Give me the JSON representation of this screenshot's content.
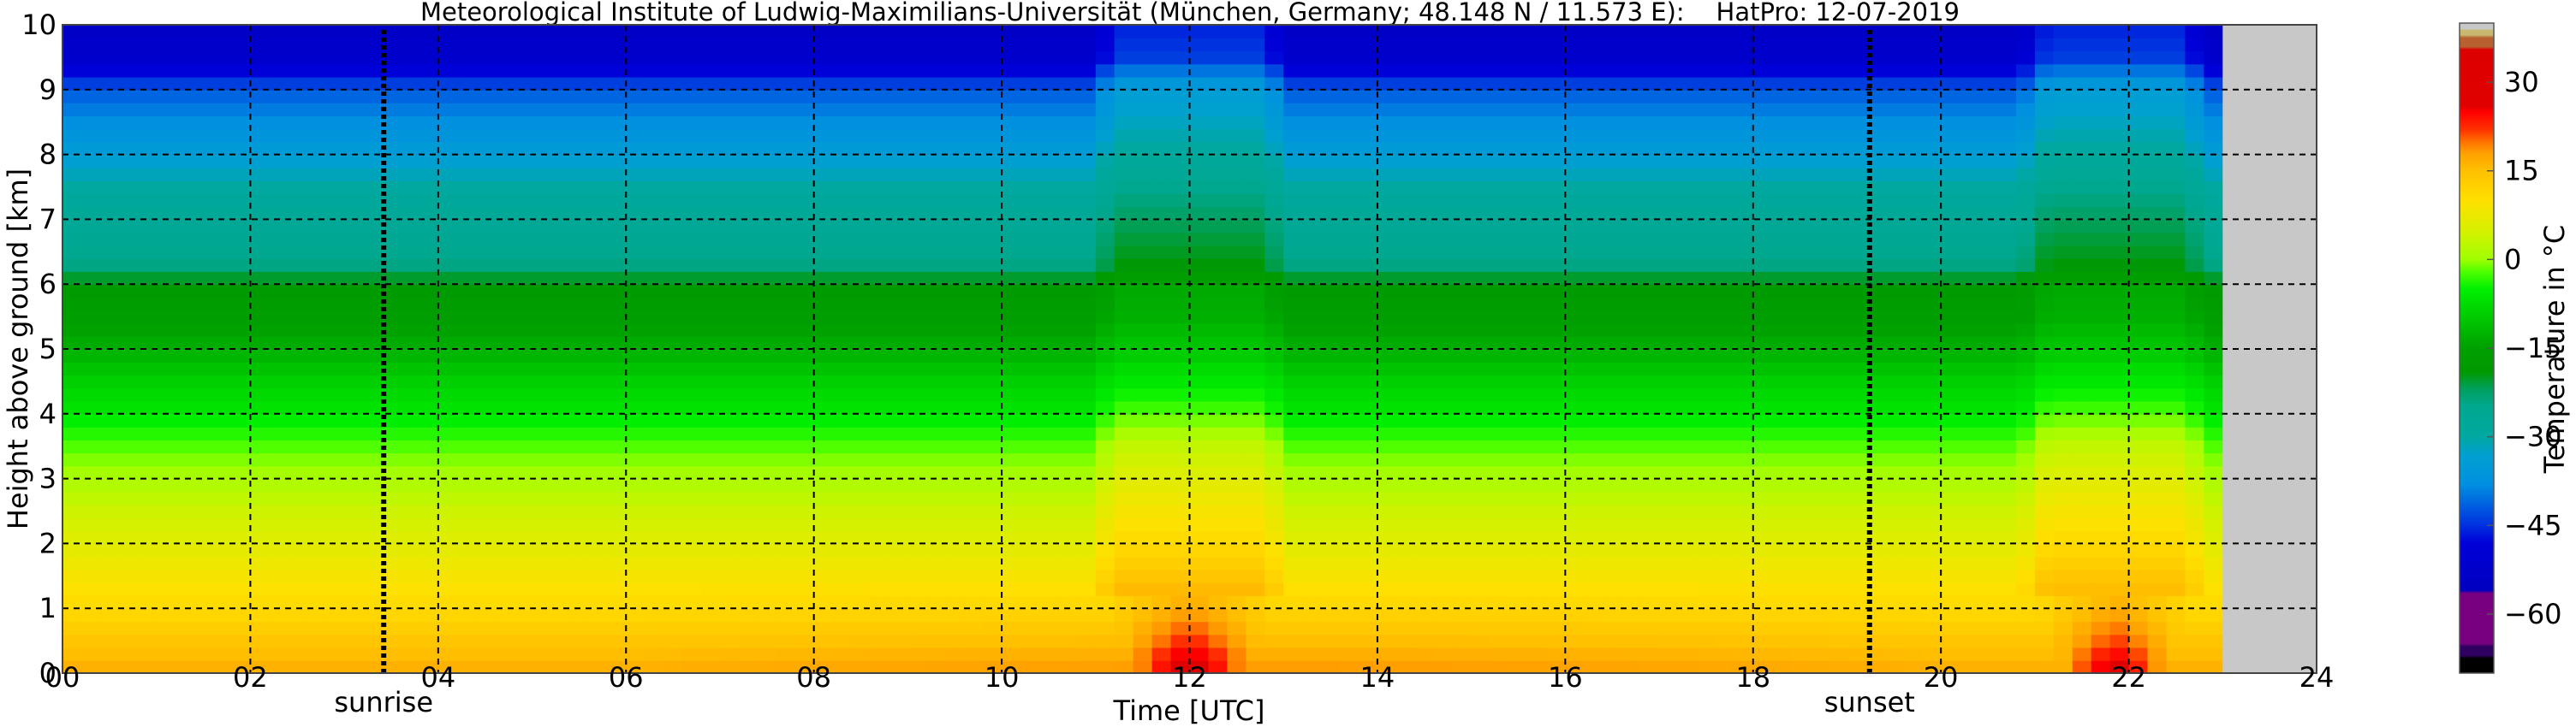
{
  "chart_data": {
    "type": "heatmap",
    "title": "Meteorological Institute of Ludwig-Maximilians-Universität (München, Germany; 48.148 N / 11.573 E):    HatPro: 12-07-2019",
    "xlabel": "Time [UTC]",
    "ylabel": "Height above ground [km]",
    "xlim": [
      0,
      24
    ],
    "ylim": [
      0,
      10
    ],
    "data_end_hour": 23.0,
    "x_ticks": [
      "00",
      "02",
      "04",
      "06",
      "08",
      "10",
      "12",
      "14",
      "16",
      "18",
      "20",
      "22",
      "24"
    ],
    "y_ticks": [
      "0",
      "1",
      "2",
      "3",
      "4",
      "5",
      "6",
      "7",
      "8",
      "9",
      "10"
    ],
    "grid": true,
    "annotations": [
      {
        "label": "sunrise",
        "hour": 3.42
      },
      {
        "label": "sunset",
        "hour": 19.24
      }
    ],
    "profile_heights_km": [
      0,
      0.5,
      1,
      1.5,
      2,
      2.5,
      3,
      3.5,
      4,
      4.5,
      5,
      5.5,
      6,
      6.25,
      6.5,
      7,
      7.5,
      8,
      8.5,
      9,
      9.25,
      9.5,
      10
    ],
    "baseline_temperature_c": [
      17,
      14,
      11,
      9,
      6,
      4,
      1,
      -2,
      -6,
      -9,
      -13,
      -16,
      -18,
      -24,
      -25,
      -27,
      -30,
      -34,
      -38,
      -42,
      -47,
      -52,
      -54
    ],
    "warm_episode_anomaly_c": [
      13,
      8,
      6,
      5,
      5,
      5,
      5,
      5,
      4,
      3,
      3,
      3,
      4,
      5,
      5,
      5,
      5,
      5,
      6,
      8,
      8,
      8,
      8
    ],
    "warm_episodes_hours": [
      [
        11.1,
        12.9
      ],
      [
        21.0,
        22.7
      ]
    ],
    "colorbar": {
      "label": "Temperature in °C",
      "range": [
        -70,
        40
      ],
      "ticks": [
        "30",
        "15",
        "0",
        "−15",
        "−30",
        "−45",
        "−60"
      ],
      "tick_values": [
        30,
        15,
        0,
        -15,
        -30,
        -45,
        -60
      ],
      "stops": [
        [
          -70,
          "#000000"
        ],
        [
          -67.5,
          "#000000"
        ],
        [
          -67,
          "#300060"
        ],
        [
          -65.5,
          "#300060"
        ],
        [
          -65,
          "#780080"
        ],
        [
          -56.5,
          "#780080"
        ],
        [
          -56,
          "#0000c0"
        ],
        [
          -48,
          "#0000d8"
        ],
        [
          -45,
          "#0030e0"
        ],
        [
          -41,
          "#0068e0"
        ],
        [
          -38,
          "#0090e0"
        ],
        [
          -33,
          "#00a0d0"
        ],
        [
          -30,
          "#00a8a0"
        ],
        [
          -25,
          "#00a890"
        ],
        [
          -22,
          "#00a060"
        ],
        [
          -19,
          "#009900"
        ],
        [
          -15,
          "#00a000"
        ],
        [
          -10,
          "#00c800"
        ],
        [
          -5,
          "#00f000"
        ],
        [
          -2,
          "#50ff00"
        ],
        [
          0,
          "#a0ff00"
        ],
        [
          5,
          "#d8f000"
        ],
        [
          10,
          "#ffe000"
        ],
        [
          15,
          "#ffc000"
        ],
        [
          18,
          "#ffa000"
        ],
        [
          20,
          "#ff7000"
        ],
        [
          22,
          "#ff3000"
        ],
        [
          25,
          "#ff0000"
        ],
        [
          26,
          "#e00000"
        ],
        [
          35.5,
          "#dd0000"
        ],
        [
          36,
          "#b86030"
        ],
        [
          37.5,
          "#b86030"
        ],
        [
          38,
          "#c8b870"
        ],
        [
          38.8,
          "#c8b870"
        ],
        [
          39,
          "#c8c8c8"
        ],
        [
          40,
          "#c8c8c8"
        ]
      ]
    },
    "no_data_color": "#c8c8c8"
  }
}
